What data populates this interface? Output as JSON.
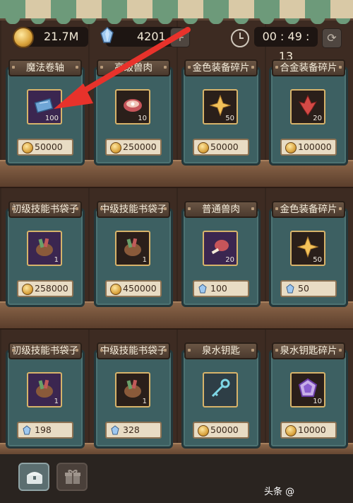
{
  "currency": {
    "gold": "21.7M",
    "gems": "4201",
    "gold_icon": "gold-coin-icon",
    "gem_icon": "crystal-gem-icon"
  },
  "timer": {
    "value": "00 : 49 : 13",
    "clock_icon": "clock-icon",
    "refresh_icon": "refresh-icon"
  },
  "shelves": [
    {
      "items": [
        {
          "name": "魔法卷轴",
          "qty": "100",
          "price": "50000",
          "currency": "gold",
          "icon": "magic-scroll-icon",
          "slot": "purple"
        },
        {
          "name": "高级兽肉",
          "qty": "10",
          "price": "250000",
          "currency": "gold",
          "icon": "meat-icon",
          "slot": "dark"
        },
        {
          "name": "金色装备碎片",
          "qty": "50",
          "price": "50000",
          "currency": "gold",
          "icon": "gold-shard-icon",
          "slot": "dark"
        },
        {
          "name": "合金装备碎片",
          "qty": "20",
          "price": "100000",
          "currency": "gold",
          "icon": "alloy-shard-icon",
          "slot": "dark"
        }
      ]
    },
    {
      "items": [
        {
          "name": "初级技能书袋子",
          "qty": "1",
          "price": "258000",
          "currency": "gold",
          "icon": "skillbook-bag-icon",
          "slot": "purple"
        },
        {
          "name": "中级技能书袋子",
          "qty": "1",
          "price": "450000",
          "currency": "gold",
          "icon": "skillbook-bag-icon",
          "slot": "dark"
        },
        {
          "name": "普通兽肉",
          "qty": "20",
          "price": "100",
          "currency": "gem",
          "icon": "meat-drumstick-icon",
          "slot": "purple"
        },
        {
          "name": "金色装备碎片",
          "qty": "50",
          "price": "50",
          "currency": "gem",
          "icon": "gold-shard-icon",
          "slot": "dark"
        }
      ]
    },
    {
      "items": [
        {
          "name": "初级技能书袋子",
          "qty": "1",
          "price": "198",
          "currency": "gem",
          "icon": "skillbook-bag-icon",
          "slot": "purple"
        },
        {
          "name": "中级技能书袋子",
          "qty": "1",
          "price": "328",
          "currency": "gem",
          "icon": "skillbook-bag-icon",
          "slot": "dark"
        },
        {
          "name": "泉水钥匙",
          "qty": "",
          "price": "50000",
          "currency": "gold",
          "icon": "spring-key-icon",
          "slot": "cyan"
        },
        {
          "name": "泉水钥匙碎片",
          "qty": "10",
          "price": "10000",
          "currency": "gold",
          "icon": "key-shard-icon",
          "slot": "dark"
        }
      ]
    }
  ],
  "tabs": [
    {
      "icon": "chest-icon",
      "active": true
    },
    {
      "icon": "gift-icon",
      "active": false
    }
  ],
  "watermark": "头条 @"
}
